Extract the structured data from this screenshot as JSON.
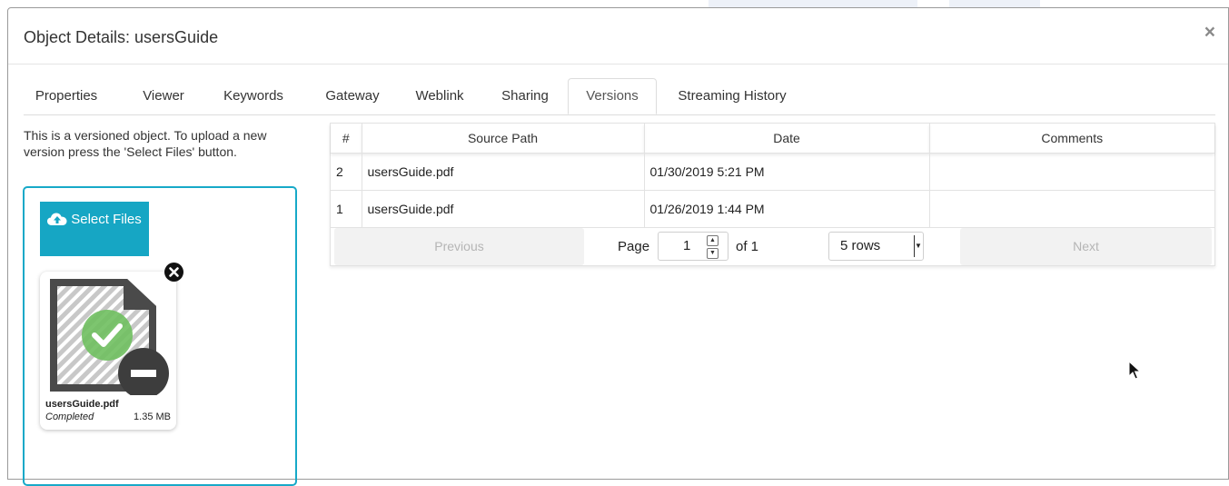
{
  "dialog": {
    "title": "Object Details: usersGuide",
    "close_label": "×"
  },
  "tabs": [
    {
      "label": "Properties"
    },
    {
      "label": "Viewer"
    },
    {
      "label": "Keywords"
    },
    {
      "label": "Gateway"
    },
    {
      "label": "Weblink"
    },
    {
      "label": "Sharing"
    },
    {
      "label": "Versions",
      "active": true
    },
    {
      "label": "Streaming History"
    }
  ],
  "upload": {
    "info_text": "This is a versioned object. To upload a new version press the 'Select Files' button.",
    "select_files_label": "Select Files",
    "file": {
      "name": "usersGuide.pdf",
      "status": "Completed",
      "size": "1.35 MB"
    }
  },
  "versions_table": {
    "columns": [
      "#",
      "Source Path",
      "Date",
      "Comments"
    ],
    "rows": [
      {
        "num": "2",
        "source_path": "usersGuide.pdf",
        "date": "01/30/2019 5:21 PM",
        "comments": ""
      },
      {
        "num": "1",
        "source_path": "usersGuide.pdf",
        "date": "01/26/2019 1:44 PM",
        "comments": ""
      }
    ]
  },
  "pagination": {
    "previous_label": "Previous",
    "page_label": "Page",
    "page_value": "1",
    "of_label": "of 1",
    "rows_selected": "5 rows",
    "next_label": "Next"
  },
  "colors": {
    "accent": "#16a6c4",
    "dropzone_border": "#17a9c8"
  }
}
